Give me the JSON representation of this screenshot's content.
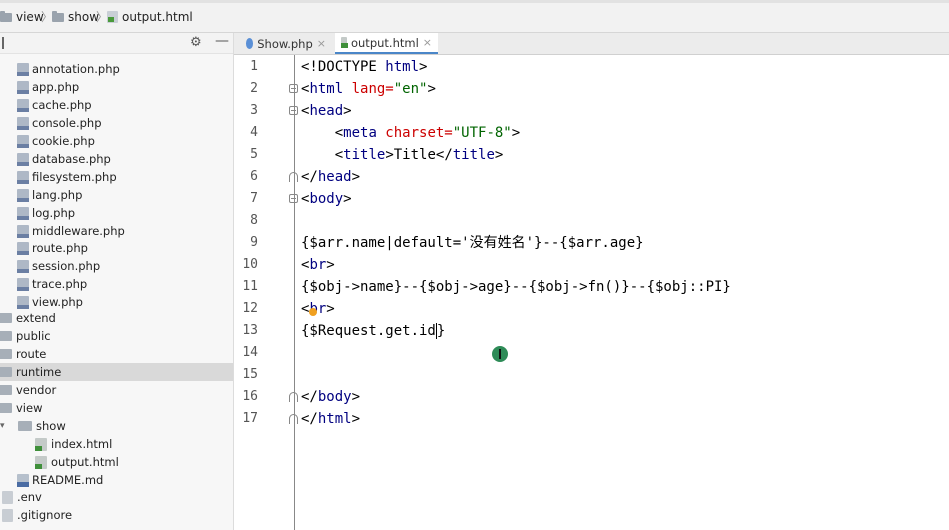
{
  "breadcrumb": {
    "items": [
      "view",
      "show",
      "output.html"
    ]
  },
  "sidebar": {
    "files": [
      {
        "name": "annotation.php",
        "type": "php"
      },
      {
        "name": "app.php",
        "type": "php"
      },
      {
        "name": "cache.php",
        "type": "php"
      },
      {
        "name": "console.php",
        "type": "php"
      },
      {
        "name": "cookie.php",
        "type": "php"
      },
      {
        "name": "database.php",
        "type": "php"
      },
      {
        "name": "filesystem.php",
        "type": "php"
      },
      {
        "name": "lang.php",
        "type": "php"
      },
      {
        "name": "log.php",
        "type": "php"
      },
      {
        "name": "middleware.php",
        "type": "php"
      },
      {
        "name": "route.php",
        "type": "php"
      },
      {
        "name": "session.php",
        "type": "php"
      },
      {
        "name": "trace.php",
        "type": "php"
      },
      {
        "name": "view.php",
        "type": "php"
      }
    ],
    "folders": [
      {
        "name": "extend"
      },
      {
        "name": "public"
      },
      {
        "name": "route"
      },
      {
        "name": "runtime",
        "selected": true
      },
      {
        "name": "vendor"
      },
      {
        "name": "view"
      }
    ],
    "show_folder": "show",
    "show_children": [
      "index.html",
      "output.html"
    ],
    "readme": "README.md",
    "root_files": [
      ".env",
      ".gitignore"
    ]
  },
  "tabs": [
    {
      "label": "Show.php",
      "active": false
    },
    {
      "label": "output.html",
      "active": true
    }
  ],
  "editor": {
    "line_numbers": [
      "1",
      "2",
      "3",
      "4",
      "5",
      "6",
      "7",
      "8",
      "9",
      "10",
      "11",
      "12",
      "13",
      "14",
      "15",
      "16",
      "17"
    ],
    "lines": {
      "l1": {
        "a": "<!DOCTYPE ",
        "b": "html",
        "c": ">"
      },
      "l2": {
        "a": "<",
        "b": "html",
        "c": " lang=",
        "d": "\"en\"",
        "e": ">"
      },
      "l3": {
        "a": "<",
        "b": "head",
        "c": ">"
      },
      "l4": {
        "a": "    <",
        "b": "meta",
        "c": " charset=",
        "d": "\"UTF-8\"",
        "e": ">"
      },
      "l5": {
        "a": "    <",
        "b": "title",
        "c": ">Title</",
        "d": "title",
        "e": ">"
      },
      "l6": {
        "a": "</",
        "b": "head",
        "c": ">"
      },
      "l7": {
        "a": "<",
        "b": "body",
        "c": ">"
      },
      "l9": "{$arr.name|default='没有姓名'}--{$arr.age}",
      "l10": {
        "a": "<",
        "b": "br",
        "c": ">"
      },
      "l11": "{$obj->name}--{$obj->age}--{$obj->fn()}--{$obj::PI}",
      "l12": {
        "a": "<",
        "b": "br",
        "c": ">"
      },
      "l13": "{$Request.get.id",
      "l13_end": "}",
      "l16": {
        "a": "</",
        "b": "body",
        "c": ">"
      },
      "l17": {
        "a": "</",
        "b": "html",
        "c": ">"
      }
    }
  }
}
